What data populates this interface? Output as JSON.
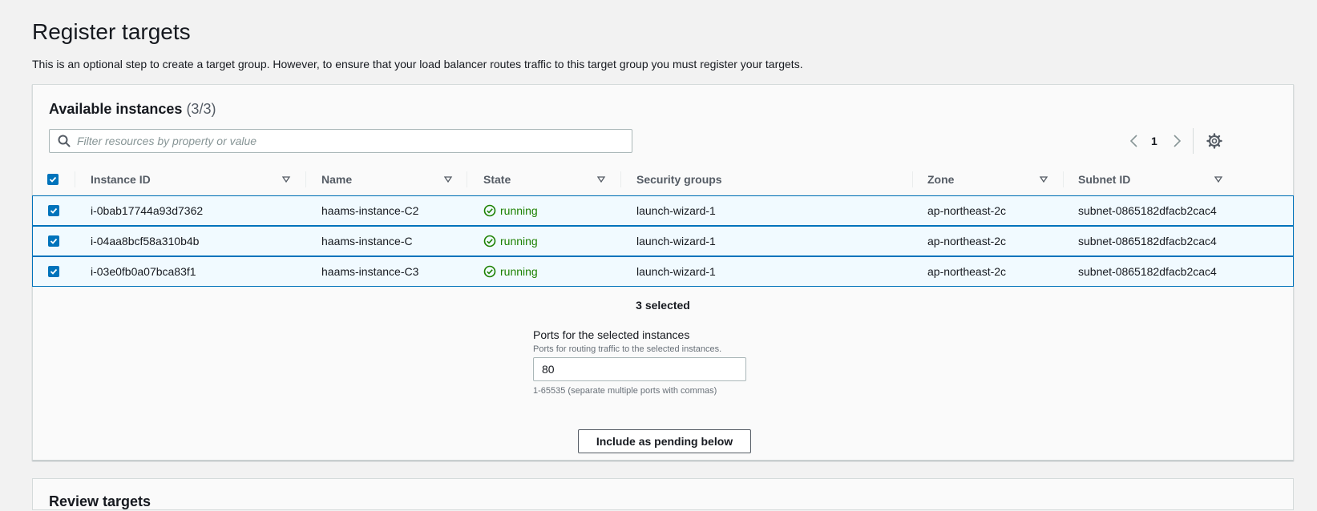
{
  "page": {
    "title": "Register targets",
    "description": "This is an optional step to create a target group. However, to ensure that your load balancer routes traffic to this target group you must register your targets."
  },
  "available": {
    "title": "Available instances",
    "count": "(3/3)",
    "filter_placeholder": "Filter resources by property or value",
    "filter_value": "",
    "page_number": "1",
    "columns": [
      "Instance ID",
      "Name",
      "State",
      "Security groups",
      "Zone",
      "Subnet ID"
    ],
    "rows": [
      {
        "instance_id": "i-0bab17744a93d7362",
        "name": "haams-instance-C2",
        "state": "running",
        "security_groups": "launch-wizard-1",
        "zone": "ap-northeast-2c",
        "subnet_id": "subnet-0865182dfacb2cac4",
        "selected": true
      },
      {
        "instance_id": "i-04aa8bcf58a310b4b",
        "name": "haams-instance-C",
        "state": "running",
        "security_groups": "launch-wizard-1",
        "zone": "ap-northeast-2c",
        "subnet_id": "subnet-0865182dfacb2cac4",
        "selected": true
      },
      {
        "instance_id": "i-03e0fb0a07bca83f1",
        "name": "haams-instance-C3",
        "state": "running",
        "security_groups": "launch-wizard-1",
        "zone": "ap-northeast-2c",
        "subnet_id": "subnet-0865182dfacb2cac4",
        "selected": true
      }
    ],
    "selected_text": "3 selected"
  },
  "ports": {
    "label": "Ports for the selected instances",
    "description": "Ports for routing traffic to the selected instances.",
    "value": "80",
    "constraint": "1-65535 (separate multiple ports with commas)",
    "button_label": "Include as pending below"
  },
  "review": {
    "title": "Review targets"
  },
  "icons": {
    "search": "search-icon",
    "prev": "chevron-left-icon",
    "next": "chevron-right-icon",
    "settings": "gear-icon",
    "sort": "sort-caret-icon",
    "status": "status-ok-icon",
    "checkbox": "checkbox-checked-icon"
  },
  "colors": {
    "accent": "#0073bb",
    "running": "#1d8102",
    "selected_row_bg": "#f1faff"
  }
}
